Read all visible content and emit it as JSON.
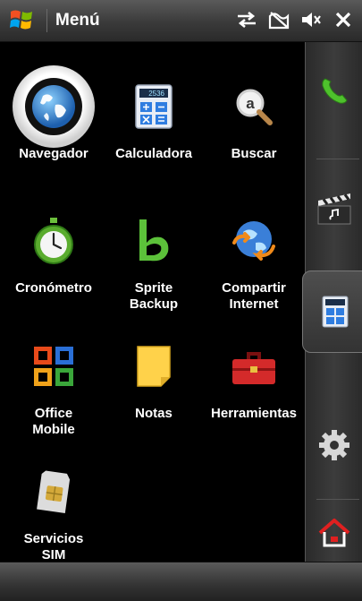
{
  "title_bar": {
    "title": "Menú",
    "windows_icon": "windows-flag-icon",
    "status_icons": [
      "connectivity-arrows-icon",
      "no-signal-icon",
      "speaker-muted-icon",
      "close-icon"
    ]
  },
  "apps": [
    {
      "label": "Navegador",
      "icon": "globe-icon"
    },
    {
      "label": "Calculadora",
      "icon": "calculator-icon"
    },
    {
      "label": "Buscar",
      "icon": "search-icon"
    },
    {
      "label": "Cronómetro",
      "icon": "stopwatch-icon"
    },
    {
      "label": "Sprite\nBackup",
      "icon": "sprite-backup-icon"
    },
    {
      "label": "Compartir\nInternet",
      "icon": "internet-sharing-icon"
    },
    {
      "label": "Office\nMobile",
      "icon": "office-icon"
    },
    {
      "label": "Notas",
      "icon": "notes-icon"
    },
    {
      "label": "Herramientas",
      "icon": "toolbox-icon"
    },
    {
      "label": "Servicios\nSIM",
      "icon": "sim-card-icon"
    }
  ],
  "sidebar": {
    "items": [
      "phone-icon",
      "media-clapper-icon",
      "calculator-icon",
      "gear-icon",
      "home-icon"
    ],
    "selected": "calculator-icon"
  },
  "colors": {
    "background": "#000000",
    "bar": "#444444",
    "label": "#ffffff",
    "accent_green": "#3aa82a",
    "home_red": "#d81e1e"
  }
}
